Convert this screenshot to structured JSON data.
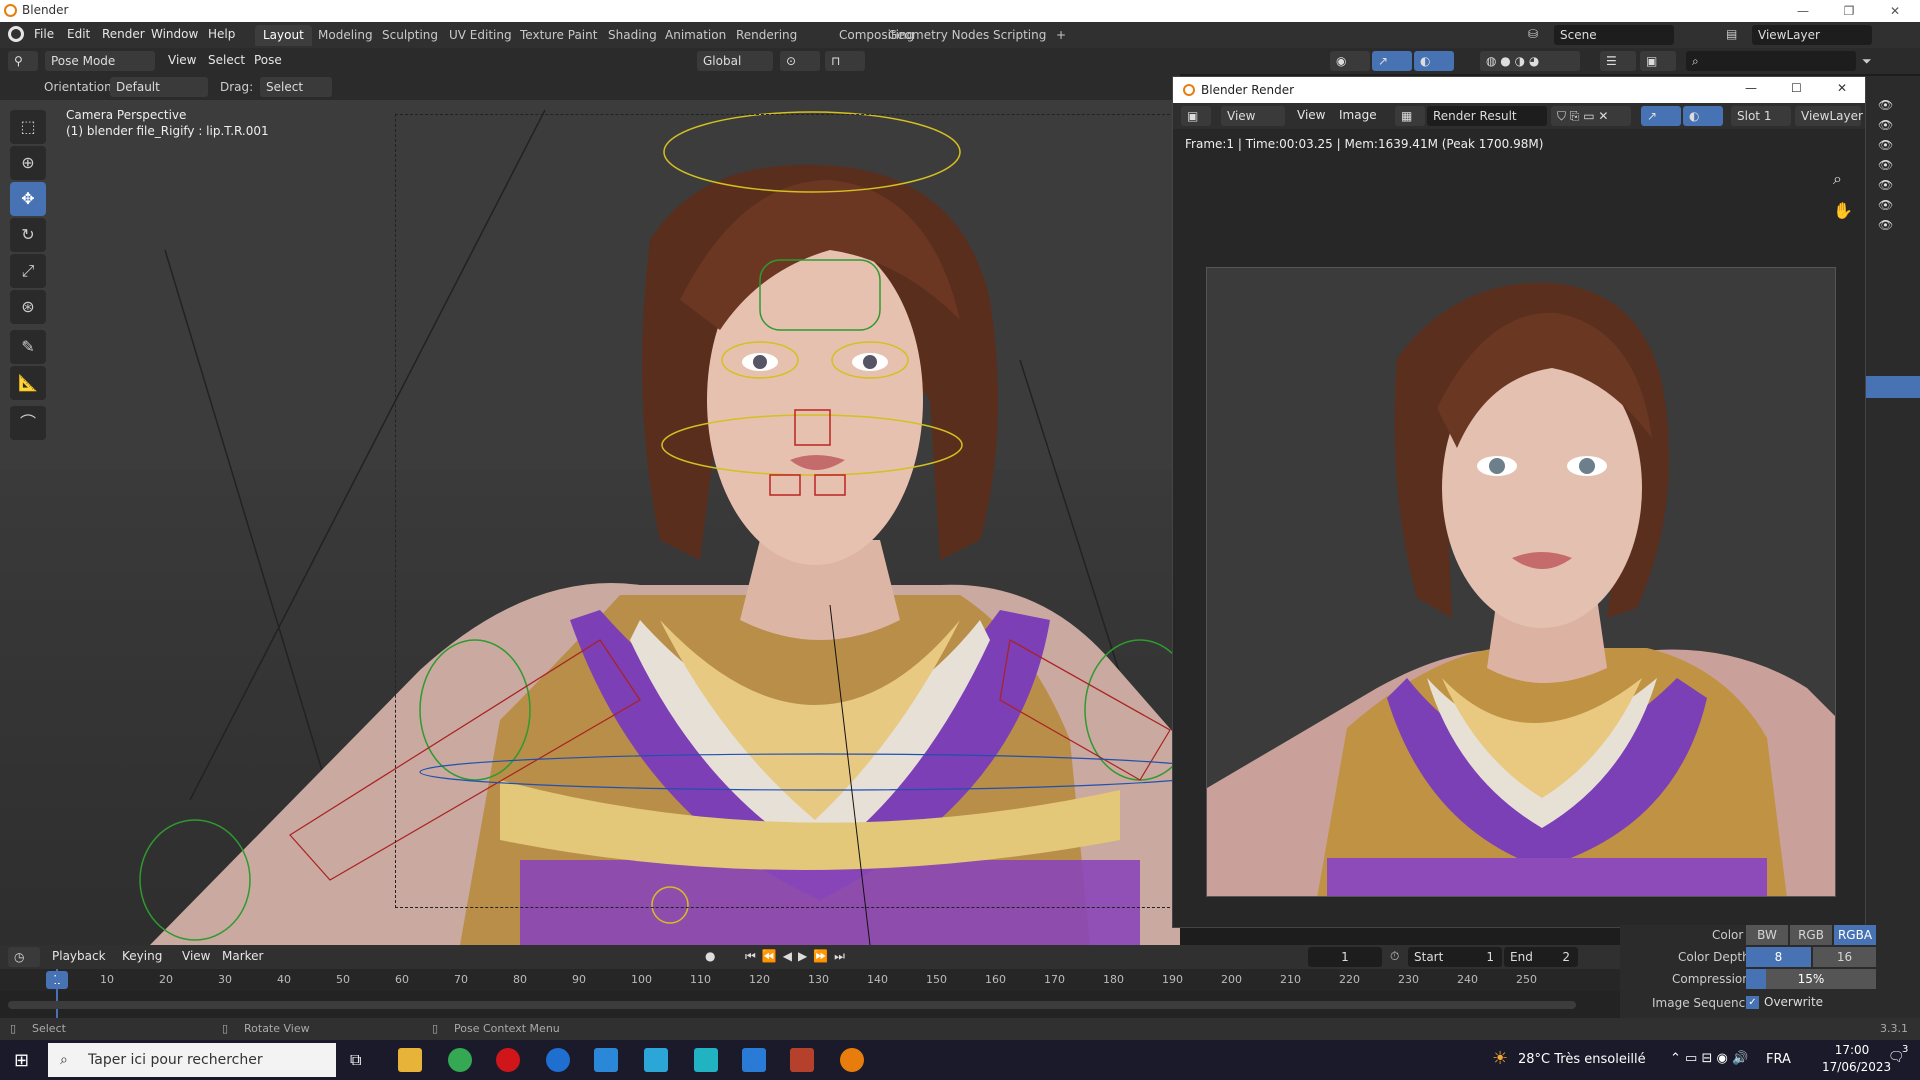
{
  "window": {
    "title": "Blender"
  },
  "menus": [
    "File",
    "Edit",
    "Render",
    "Window",
    "Help"
  ],
  "workspaces": [
    "Layout",
    "Modeling",
    "Sculpting",
    "UV Editing",
    "Texture Paint",
    "Shading",
    "Animation",
    "Rendering",
    "Compositing",
    "Geometry Nodes",
    "Scripting"
  ],
  "active_workspace": "Layout",
  "scene": {
    "scene_name": "Scene",
    "view_layer": "ViewLayer"
  },
  "header": {
    "mode": "Pose Mode",
    "menu_view": "View",
    "menu_select": "Select",
    "menu_pose": "Pose",
    "transform_orientation": "Global",
    "orientation_label": "Orientation:",
    "orientation_value": "Default",
    "drag_label": "Drag:",
    "drag_value": "Select Box"
  },
  "viewport": {
    "overlay_line1": "Camera Perspective",
    "overlay_line2": "(1) blender file_Rigify : lip.T.R.001"
  },
  "tools": [
    "select-box",
    "cursor",
    "move",
    "rotate",
    "scale",
    "transform",
    "annotate",
    "measure",
    "bone-roll"
  ],
  "render_window": {
    "title": "Blender Render",
    "menu_view": "View",
    "menu_view2": "View",
    "menu_image": "Image",
    "image_name": "Render Result",
    "slot": "Slot 1",
    "view_layer": "ViewLayer",
    "stats": "Frame:1 | Time:00:03.25 | Mem:1639.41M (Peak 1700.98M)"
  },
  "output_props": {
    "color_label": "Color",
    "color_options": [
      "BW",
      "RGB",
      "RGBA"
    ],
    "color_selected": "RGBA",
    "depth_label": "Color Depth",
    "depth_options": [
      "8",
      "16"
    ],
    "depth_selected": "8",
    "compression_label": "Compression",
    "compression_value": "15%",
    "compression_fraction": 0.15,
    "sequence_label": "Image Sequence",
    "overwrite_label": "Overwrite"
  },
  "timeline": {
    "playback": "Playback",
    "keying": "Keying",
    "view": "View",
    "marker": "Marker",
    "current_frame": "1",
    "start_label": "Start",
    "start_value": "1",
    "end_label": "End",
    "end_value": "2",
    "ticks": [
      "10",
      "20",
      "30",
      "40",
      "50",
      "60",
      "70",
      "80",
      "90",
      "100",
      "110",
      "120",
      "130",
      "140",
      "150",
      "160",
      "170",
      "180",
      "190",
      "200",
      "210",
      "220",
      "230",
      "240",
      "250"
    ],
    "playhead": "1"
  },
  "statusbar": {
    "select": "Select",
    "rotate": "Rotate View",
    "context": "Pose Context Menu",
    "version": "3.3.1"
  },
  "taskbar": {
    "search_placeholder": "Taper ici pour rechercher",
    "weather": "28°C  Très ensoleillé",
    "lang": "FRA",
    "time": "17:00",
    "date": "17/06/2023",
    "notifications": "3"
  },
  "colors": {
    "accent": "#4772b3",
    "blender_orange": "#e87d0d"
  }
}
